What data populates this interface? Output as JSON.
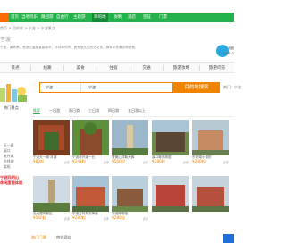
{
  "nav": {
    "items": [
      "首页",
      "当地玩乐",
      "跟团游",
      "自由行",
      "主题游",
      "目的地",
      "攻略",
      "酒店",
      "签证",
      "门票"
    ],
    "active_index": 5
  },
  "breadcrumb": "首页 > 目的地 > 宁波 > 宁波景点",
  "header": {
    "title": "宁波",
    "description": "宁波，简称甬，是浙江省副省级城市，计划单列市，具有悠久的历史文化，拥有众多景点和美食。",
    "fav_label": "收藏",
    "fav_count": "179822"
  },
  "tabs": [
    "景点",
    "线路",
    "美食",
    "住宿",
    "交通",
    "旅游攻略",
    "旅游问答"
  ],
  "search": {
    "select": "宁波",
    "placeholder": "宁波",
    "value": "宁波",
    "button": "目的地搜索",
    "right_snip": "热门：宁波"
  },
  "side": {
    "title": "热门景点",
    "items": [
      "天一阁",
      "溪口",
      "老外滩",
      "东钱湖",
      "梁祝"
    ]
  },
  "filters": {
    "items": [
      "推荐",
      "一日游",
      "两日游",
      "三日游",
      "四日游",
      "五日游以上"
    ],
    "active_index": 0
  },
  "cards": [
    {
      "caption": "宁波天一阁·月湖",
      "price": "¥80起",
      "comments": "点评"
    },
    {
      "caption": "宁波老外滩一日",
      "price": "¥243起",
      "comments": "点评"
    },
    {
      "caption": "雪窦山弥勒大佛",
      "price": "¥560起",
      "comments": "点评"
    },
    {
      "caption": "溪口蒋氏故居",
      "price": "¥280起",
      "comments": "点评"
    },
    {
      "caption": "东钱湖小普陀",
      "price": "¥280起",
      "comments": "点评"
    },
    {
      "caption": "五龙潭风景区",
      "price": "¥560起",
      "comments": "点评"
    },
    {
      "caption": "宁波方特东方神画",
      "price": "¥280起",
      "comments": "点评"
    },
    {
      "caption": "宁波博物馆",
      "price": "¥280起",
      "comments": "点评"
    }
  ],
  "promo": {
    "line1": "宁波四明山",
    "line2": "休闲度假体验"
  },
  "bottom": {
    "hot": "热门门票",
    "items": [
      "特价酒店",
      "",
      ""
    ]
  }
}
